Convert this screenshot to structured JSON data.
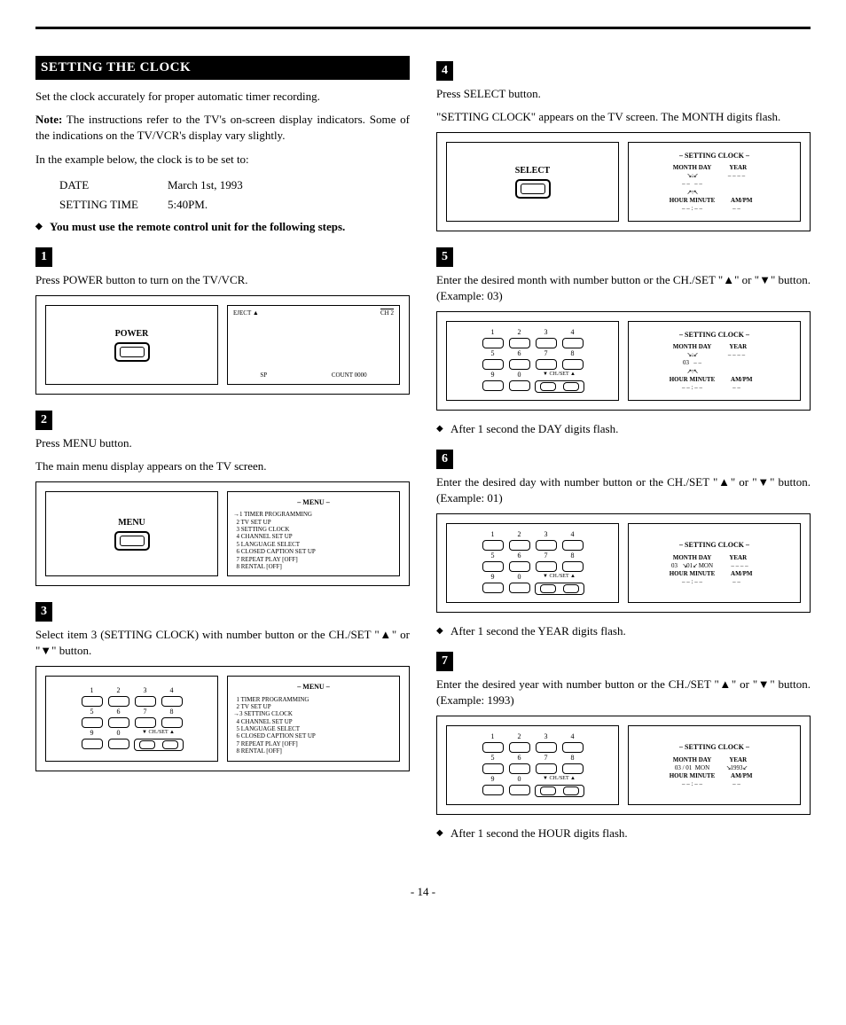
{
  "header": {
    "section_title": "SETTING THE CLOCK"
  },
  "intro": {
    "p1": "Set the clock accurately for proper automatic timer recording.",
    "note_label": "Note:",
    "note_text": " The instructions refer to the TV's on-screen display indicators. Some of the indications on the TV/VCR's display vary slightly.",
    "example_intro": "In the example below, the clock is to be set to:",
    "date_label": "DATE",
    "date_value": "March 1st, 1993",
    "time_label": "SETTING TIME",
    "time_value": "5:40PM.",
    "bullet1": "You must use the remote control unit for the following steps."
  },
  "buttons": {
    "power": "POWER",
    "menu": "MENU",
    "select": "SELECT",
    "eject": "EJECT ▲",
    "chset": "CH./SET"
  },
  "tv": {
    "ch": "CH 2",
    "sp": "SP",
    "count": "COUNT  0000",
    "menu_title": "– MENU –",
    "menu_items": {
      "i1": "1 TIMER PROGRAMMING",
      "i2": "2 TV SET UP",
      "i3": "3 SETTING CLOCK",
      "i4": "4 CHANNEL SET UP",
      "i5": "5 LANGUAGE SELECT",
      "i6": "6 CLOSED CAPTION SET UP",
      "i7": "7 REPEAT PLAY        [OFF]",
      "i8": "8 RENTAL                [OFF]"
    },
    "clock_title": "– SETTING CLOCK –",
    "labels": {
      "month_day": "MONTH DAY",
      "year": "YEAR",
      "hour_minute": "HOUR  MINUTE",
      "ampm": "AM/PM"
    },
    "vals": {
      "dashes": "– –",
      "dashes4": "– – – –",
      "time_dashes": "– –  :  – –",
      "v03": "03",
      "v01": "01",
      "mon": "MON",
      "v1993": "1993",
      "slash": " / "
    }
  },
  "steps": {
    "s1": {
      "num": "1",
      "text": "Press POWER button to turn on the TV/VCR."
    },
    "s2": {
      "num": "2",
      "text1": "Press MENU button.",
      "text2": "The main menu display appears on the TV screen."
    },
    "s3": {
      "num": "3",
      "text": "Select item 3 (SETTING CLOCK) with number button or the CH./SET \"▲\" or \"▼\" button."
    },
    "s4": {
      "num": "4",
      "text1": "Press SELECT button.",
      "text2": "\"SETTING CLOCK\" appears on the TV screen. The MONTH digits flash."
    },
    "s5": {
      "num": "5",
      "text": "Enter the desired month with number button or the CH./SET \"▲\" or \"▼\" button. (Example: 03)",
      "after": "After 1 second the DAY digits flash."
    },
    "s6": {
      "num": "6",
      "text": "Enter the desired day with number button or the CH./SET \"▲\" or \"▼\" button. (Example: 01)",
      "after": "After 1 second the YEAR digits flash."
    },
    "s7": {
      "num": "7",
      "text": "Enter the desired year with number button or the CH./SET \"▲\" or \"▼\" button. (Example: 1993)",
      "after": "After 1 second the HOUR digits flash."
    }
  },
  "keypad": {
    "n1": "1",
    "n2": "2",
    "n3": "3",
    "n4": "4",
    "n5": "5",
    "n6": "6",
    "n7": "7",
    "n8": "8",
    "n9": "9",
    "n0": "0",
    "chset_up": "▲",
    "chset_dn": "▼"
  },
  "page_number": "- 14 -"
}
